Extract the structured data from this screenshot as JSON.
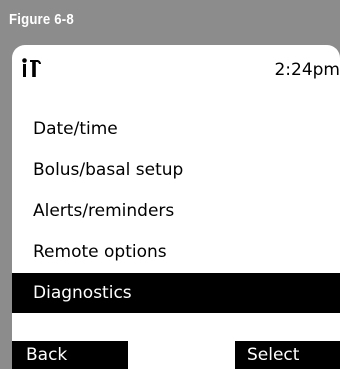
{
  "figure": {
    "label": "Figure 6-8"
  },
  "status_bar": {
    "icon": "settings-tools-icon",
    "time": "2:24pm"
  },
  "menu": {
    "items": [
      {
        "label": "Date/time"
      },
      {
        "label": "Bolus/basal setup"
      },
      {
        "label": "Alerts/reminders"
      },
      {
        "label": "Remote options"
      },
      {
        "label": "Diagnostics",
        "selected": true
      }
    ]
  },
  "softkeys": {
    "back_label": "Back",
    "select_label": "Select"
  },
  "colors": {
    "frame": "#8c8c8c",
    "screen": "#ffffff",
    "highlight": "#000000",
    "highlight_text": "#ffffff"
  }
}
